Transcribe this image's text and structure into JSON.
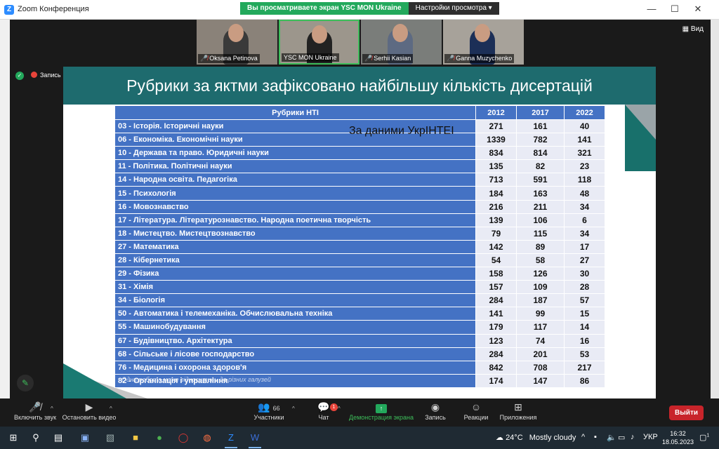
{
  "window": {
    "title": "Zoom Конференция",
    "share_banner": "Вы просматриваете экран YSC MON Ukraine",
    "view_options": "Настройки просмотра ▾",
    "minimize": "—",
    "maximize": "☐",
    "close": "✕"
  },
  "participants": [
    {
      "name": "Oksana Petinova",
      "muted": true,
      "active": false
    },
    {
      "name": "YSC MON Ukraine",
      "muted": false,
      "active": true
    },
    {
      "name": "Serhii Kasian",
      "muted": true,
      "active": false
    },
    {
      "name": "Ganna Muzychenko",
      "muted": true,
      "active": false
    }
  ],
  "view_label": "Вид",
  "recording_label": "Запись",
  "slide": {
    "title": "Рубрики за яктми зафіксовано найбільшу кількість дисертацій",
    "source_note": "За даними УкрІНТЕІ",
    "footnote": "Одна робота може відноситись до різних галузей",
    "table": {
      "headers": [
        "Рубрики НТІ",
        "2012",
        "2017",
        "2022"
      ],
      "rows": [
        [
          "03 - Історія. Історичні науки",
          "271",
          "161",
          "40"
        ],
        [
          "06 - Економіка. Економічні науки",
          "1339",
          "782",
          "141"
        ],
        [
          "10 - Держава та право. Юридичні науки",
          "834",
          "814",
          "321"
        ],
        [
          "11 - Політика. Політичні науки",
          "135",
          "82",
          "23"
        ],
        [
          "14 - Народна освіта. Педагогіка",
          "713",
          "591",
          "118"
        ],
        [
          "15 - Психологія",
          "184",
          "163",
          "48"
        ],
        [
          "16 - Мовознавство",
          "216",
          "211",
          "34"
        ],
        [
          "17 - Література. Літературознавство. Народна поетична творчість",
          "139",
          "106",
          "6"
        ],
        [
          "18 - Мистецтво. Мистецтвознавство",
          "79",
          "115",
          "34"
        ],
        [
          "27 - Математика",
          "142",
          "89",
          "17"
        ],
        [
          "28 - Кібернетика",
          "54",
          "58",
          "27"
        ],
        [
          "29 - Фізика",
          "158",
          "126",
          "30"
        ],
        [
          "31 - Хімія",
          "157",
          "109",
          "28"
        ],
        [
          "34 - Біологія",
          "284",
          "187",
          "57"
        ],
        [
          "50 - Автоматика і телемеханіка. Обчислювальна техніка",
          "141",
          "99",
          "15"
        ],
        [
          "55 - Машинобудування",
          "179",
          "117",
          "14"
        ],
        [
          "67 - Будівництво. Архітектура",
          "123",
          "74",
          "16"
        ],
        [
          "68 - Сільське і лісове господарство",
          "284",
          "201",
          "53"
        ],
        [
          "76 - Медицина і охорона здоров'я",
          "842",
          "708",
          "217"
        ],
        [
          "82 - Організація і управління",
          "174",
          "147",
          "86"
        ]
      ]
    }
  },
  "toolbar": {
    "mute": "Включить звук",
    "video": "Остановить видео",
    "participants": "Участники",
    "participants_count": "66",
    "chat": "Чат",
    "chat_badge": "1",
    "share": "Демонстрация экрана",
    "record": "Запись",
    "reactions": "Реакции",
    "apps": "Приложения",
    "leave": "Выйти"
  },
  "taskbar": {
    "weather_temp": "24°C",
    "weather_desc": "Mostly cloudy",
    "language": "УКР",
    "time": "16:32",
    "date": "18.05.2023",
    "notifications": "1"
  },
  "colors": {
    "slide_header": "#1e6b6e",
    "table_header": "#4472c4",
    "table_num_bg": "#e9ebf5",
    "share_green": "#23a95c",
    "leave_red": "#c8242a"
  }
}
